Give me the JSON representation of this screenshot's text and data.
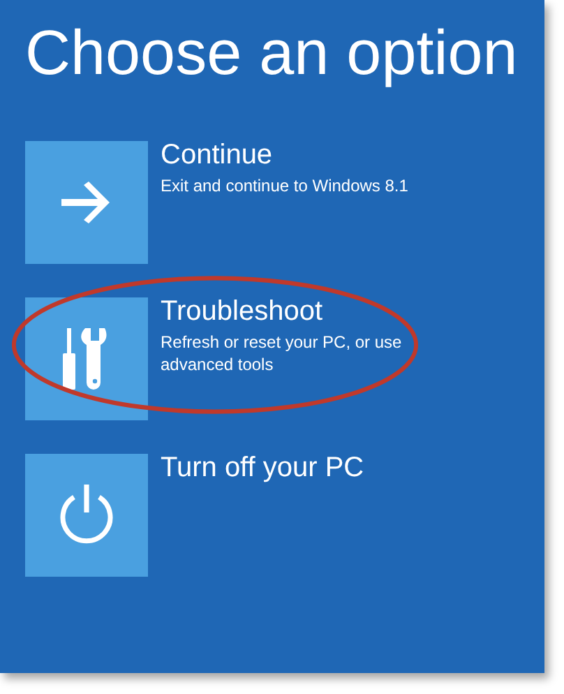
{
  "title": "Choose an option",
  "options": [
    {
      "label": "Continue",
      "description": "Exit and continue to Windows 8.1",
      "highlighted": false
    },
    {
      "label": "Troubleshoot",
      "description": "Refresh or reset your PC, or use advanced tools",
      "highlighted": true
    },
    {
      "label": "Turn off your PC",
      "highlighted": false
    }
  ]
}
